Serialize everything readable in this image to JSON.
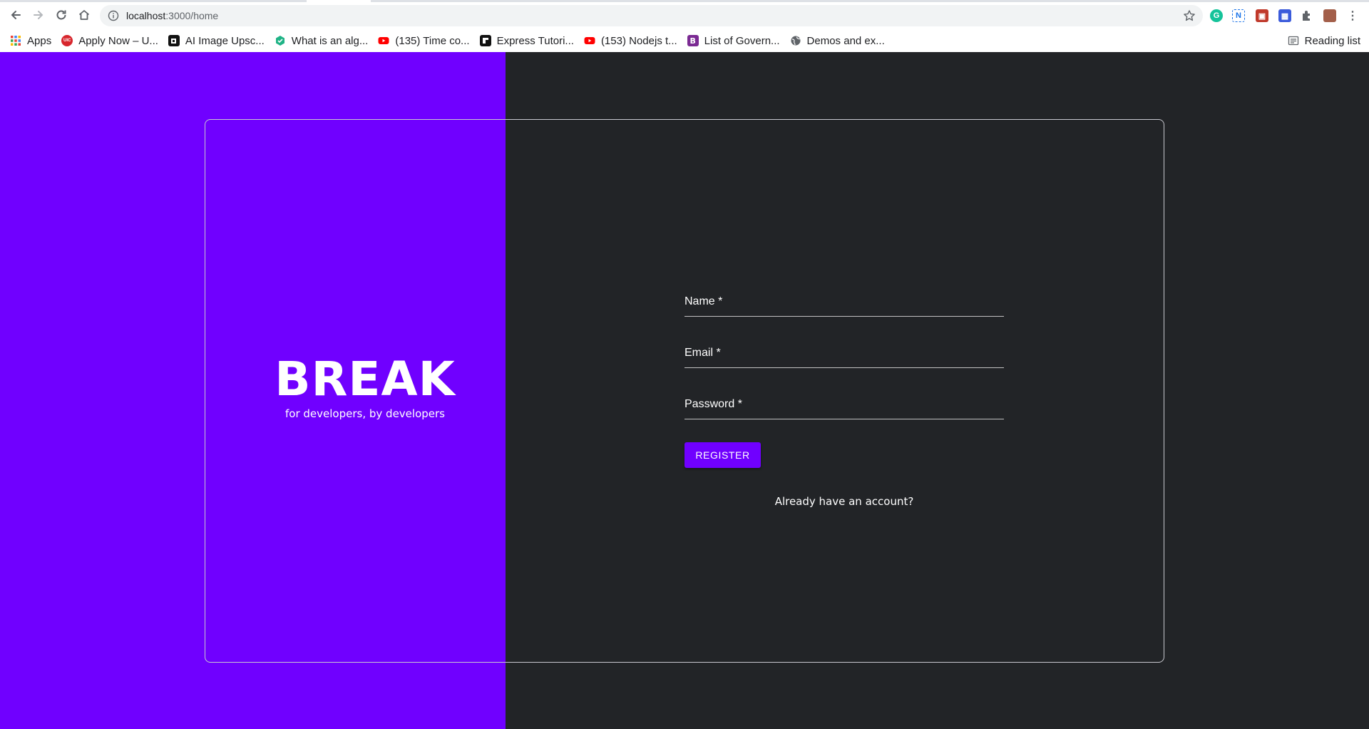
{
  "browser": {
    "url_host": "localhost",
    "url_path": ":3000/home",
    "bookmarks": [
      {
        "label": "Apps",
        "icon": "apps-grid-icon"
      },
      {
        "label": "Apply Now – U...",
        "icon": "uic-icon",
        "color": "#d7262d"
      },
      {
        "label": "AI Image Upsc...",
        "icon": "upscale-icon",
        "color": "#111111"
      },
      {
        "label": "What is an alg...",
        "icon": "hex-icon",
        "color": "#1fb386"
      },
      {
        "label": "(135) Time co...",
        "icon": "youtube-icon",
        "color": "#ff0000"
      },
      {
        "label": "Express Tutori...",
        "icon": "express-icon",
        "color": "#111111"
      },
      {
        "label": "(153) Nodejs t...",
        "icon": "youtube-icon",
        "color": "#ff0000"
      },
      {
        "label": "List of Govern...",
        "icon": "bootstrap-icon",
        "color": "#7b2a93"
      },
      {
        "label": "Demos and ex...",
        "icon": "globe-icon",
        "color": "#5f6368"
      }
    ],
    "reading_list_label": "Reading list"
  },
  "page": {
    "colors": {
      "accent": "#7000ff",
      "background": "#222427",
      "text": "#ffffff"
    },
    "brand": {
      "title": "BREAK",
      "tagline": "for developers, by developers"
    },
    "form": {
      "name_label": "Name *",
      "email_label": "Email *",
      "password_label": "Password *",
      "register_label": "REGISTER",
      "login_prompt": "Already have an account?"
    }
  }
}
